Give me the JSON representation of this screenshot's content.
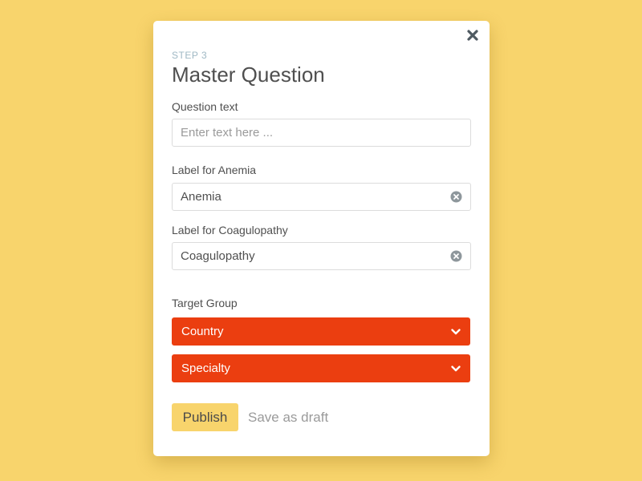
{
  "modal": {
    "step_label": "STEP 3",
    "title": "Master Question"
  },
  "form": {
    "question_text": {
      "label": "Question text",
      "placeholder": "Enter text here ...",
      "value": ""
    },
    "anemia": {
      "label": "Label for Anemia",
      "value": "Anemia"
    },
    "coagulopathy": {
      "label": "Label for Coagulopathy",
      "value": "Coagulopathy"
    },
    "target_group": {
      "label": "Target Group",
      "selects": [
        {
          "value": "Country"
        },
        {
          "value": "Specialty"
        }
      ]
    }
  },
  "actions": {
    "publish_label": "Publish",
    "draft_label": "Save as draft"
  },
  "icons": {
    "close": "close-icon",
    "clear": "clear-circle-icon",
    "dropdown": "chevron-down-icon"
  },
  "colors": {
    "background": "#f8d46c",
    "select_fill": "#eb3e10",
    "step_label": "#9fb8c4",
    "publish_button": "#f8d46c"
  }
}
